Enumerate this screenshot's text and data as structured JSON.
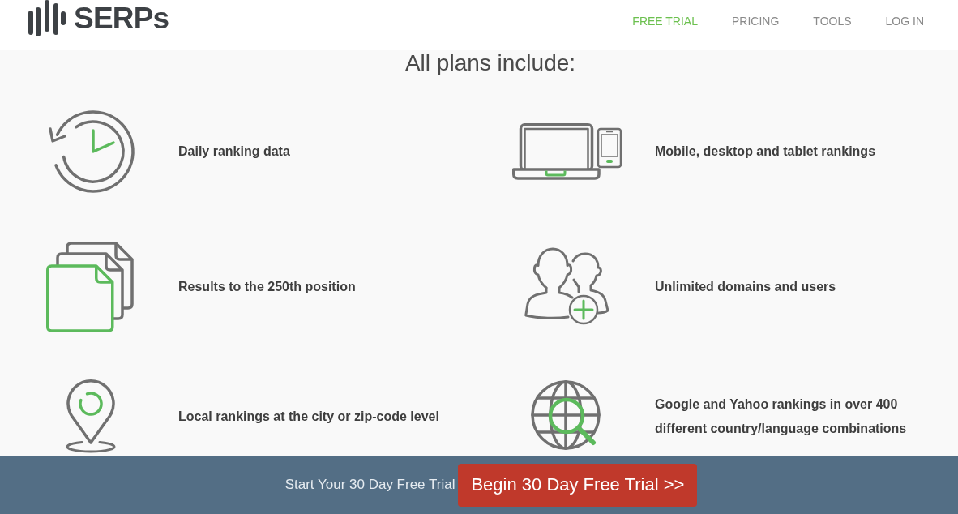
{
  "header": {
    "logo": {
      "text": "SERPs"
    },
    "nav": [
      {
        "label": "FREE TRIAL",
        "highlighted": true
      },
      {
        "label": "PRICING",
        "highlighted": false
      },
      {
        "label": "TOOLS",
        "highlighted": false
      },
      {
        "label": "LOG IN",
        "highlighted": false
      }
    ]
  },
  "heading": "All plans include:",
  "features": [
    {
      "kind": "clock",
      "text": "Daily ranking data"
    },
    {
      "kind": "documents",
      "text": "Results to the 250th position"
    },
    {
      "kind": "pin",
      "text": "Local rankings at the city or zip-code level"
    },
    {
      "kind": "devices",
      "text": "Mobile, desktop and tablet rankings"
    },
    {
      "kind": "users",
      "text": "Unlimited domains and users"
    },
    {
      "kind": "globe",
      "text": "Google and Yahoo rankings in over 400 different country/language combinations"
    }
  ],
  "cta_bar": {
    "text": "Start Your 30 Day Free Trial",
    "button": "Begin 30 Day Free Trial >>"
  }
}
